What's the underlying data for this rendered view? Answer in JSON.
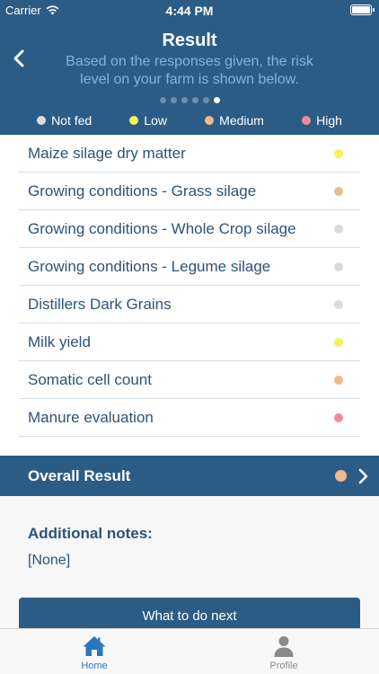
{
  "status_bar": {
    "carrier": "Carrier",
    "time": "4:44 PM"
  },
  "header": {
    "title": "Result",
    "subtitle": "Based on the responses given, the risk level on your farm is shown below.",
    "page_count": 6,
    "active_page": 5
  },
  "legend": [
    {
      "label": "Not fed",
      "color": "#d9dcdf"
    },
    {
      "label": "Low",
      "color": "#f5f15a"
    },
    {
      "label": "Medium",
      "color": "#f2b98a"
    },
    {
      "label": "High",
      "color": "#f18b93"
    }
  ],
  "results": [
    {
      "label": "Maize silage dry matter",
      "level": "Low",
      "color": "#f5f15a"
    },
    {
      "label": "Growing conditions - Grass silage",
      "level": "Medium",
      "color": "#f2b98a"
    },
    {
      "label": "Growing conditions - Whole Crop silage",
      "level": "Not fed",
      "color": "#d9dcdf"
    },
    {
      "label": "Growing conditions - Legume silage",
      "level": "Not fed",
      "color": "#d9dcdf"
    },
    {
      "label": "Distillers Dark Grains",
      "level": "Not fed",
      "color": "#d9dcdf"
    },
    {
      "label": "Milk yield",
      "level": "Low",
      "color": "#f5f15a"
    },
    {
      "label": "Somatic cell count",
      "level": "Medium",
      "color": "#f2b98a"
    },
    {
      "label": "Manure evaluation",
      "level": "High",
      "color": "#f18b93"
    }
  ],
  "overall": {
    "label": "Overall Result",
    "level": "Medium",
    "color": "#f2b98a"
  },
  "notes": {
    "title": "Additional notes:",
    "value": "[None]"
  },
  "next_button": {
    "label": "What to do next"
  },
  "tabs": {
    "home": "Home",
    "profile": "Profile"
  },
  "icons": {
    "back": "chevron-left-icon",
    "overall_arrow": "chevron-right-icon",
    "home": "home-icon",
    "profile": "person-icon"
  },
  "colors": {
    "primary": "#2b5c85",
    "text": "#2c5378",
    "active_tab": "#2c76bf"
  }
}
